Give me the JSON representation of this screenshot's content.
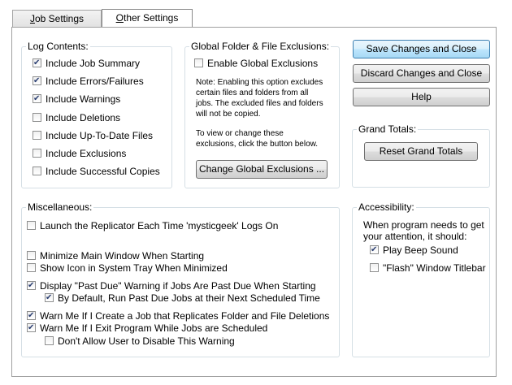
{
  "tabs": {
    "job_settings_key": "J",
    "job_settings_rest": "ob Settings",
    "other_settings_key": "O",
    "other_settings_rest": "ther Settings"
  },
  "log_contents": {
    "title": "Log Contents:",
    "items": [
      {
        "label": "Include Job Summary",
        "checked": true
      },
      {
        "label": "Include Errors/Failures",
        "checked": true
      },
      {
        "label": "Include Warnings",
        "checked": true
      },
      {
        "label": "Include Deletions",
        "checked": false
      },
      {
        "label": "Include Up-To-Date Files",
        "checked": false
      },
      {
        "label": "Include Exclusions",
        "checked": false
      },
      {
        "label": "Include Successful Copies",
        "checked": false
      }
    ]
  },
  "global_exclusions": {
    "title": "Global Folder & File Exclusions:",
    "enable_label": "Enable Global Exclusions",
    "enable_checked": false,
    "note1": [
      "Note: Enabling this option excludes",
      "certain files and folders from all",
      "jobs. The excluded files and folders",
      "will not be copied."
    ],
    "note2": [
      "To view or change these",
      "exclusions, click the button below."
    ],
    "change_button": "Change Global Exclusions ..."
  },
  "actions": {
    "save": "Save Changes and Close",
    "discard": "Discard Changes and Close",
    "help": "Help"
  },
  "grand_totals": {
    "title": "Grand Totals:",
    "reset_button": "Reset Grand Totals"
  },
  "misc": {
    "title": "Miscellaneous:",
    "items": [
      {
        "label": "Launch the Replicator Each Time 'mysticgeek' Logs On",
        "checked": false
      },
      {
        "label": "Minimize Main Window When Starting",
        "checked": false
      },
      {
        "label": "Show Icon in System Tray When Minimized",
        "checked": false
      },
      {
        "label": "Display \"Past Due\" Warning if Jobs Are Past Due When Starting",
        "checked": true
      },
      {
        "label": "By Default, Run Past Due Jobs at their Next Scheduled Time",
        "checked": true
      },
      {
        "label": "Warn Me If I Create a Job that Replicates Folder and File Deletions",
        "checked": true
      },
      {
        "label": "Warn Me If I Exit Program While Jobs are Scheduled",
        "checked": true
      },
      {
        "label": "Don't Allow User to Disable This Warning",
        "checked": false
      }
    ]
  },
  "accessibility": {
    "title": "Accessibility:",
    "intro": [
      "When program needs to get",
      "your attention, it should:"
    ],
    "items": [
      {
        "label": "Play Beep Sound",
        "checked": true
      },
      {
        "label": "\"Flash\" Window Titlebar",
        "checked": false
      }
    ]
  }
}
